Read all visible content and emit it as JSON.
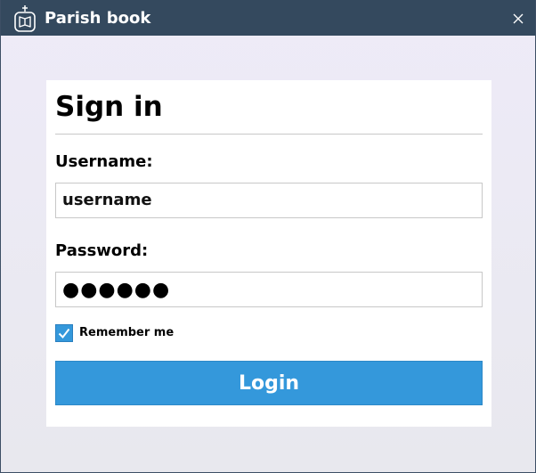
{
  "window": {
    "title": "Parish book",
    "app_icon": "book-cross-icon",
    "close_icon": "close-icon"
  },
  "form": {
    "heading": "Sign in",
    "username_label": "Username:",
    "username_value": "username",
    "password_label": "Password:",
    "password_mask": "●●●●●●",
    "remember_label": "Remember me",
    "remember_checked": true,
    "login_label": "Login"
  },
  "colors": {
    "titlebar": "#34495e",
    "accent": "#3498db"
  }
}
